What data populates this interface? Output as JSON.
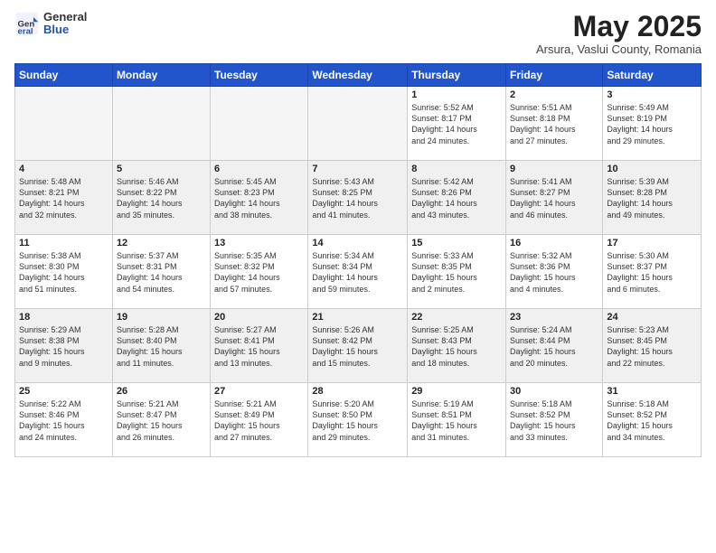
{
  "logo": {
    "general": "General",
    "blue": "Blue"
  },
  "title": "May 2025",
  "subtitle": "Arsura, Vaslui County, Romania",
  "headers": [
    "Sunday",
    "Monday",
    "Tuesday",
    "Wednesday",
    "Thursday",
    "Friday",
    "Saturday"
  ],
  "weeks": [
    [
      {
        "day": "",
        "info": ""
      },
      {
        "day": "",
        "info": ""
      },
      {
        "day": "",
        "info": ""
      },
      {
        "day": "",
        "info": ""
      },
      {
        "day": "1",
        "info": "Sunrise: 5:52 AM\nSunset: 8:17 PM\nDaylight: 14 hours\nand 24 minutes."
      },
      {
        "day": "2",
        "info": "Sunrise: 5:51 AM\nSunset: 8:18 PM\nDaylight: 14 hours\nand 27 minutes."
      },
      {
        "day": "3",
        "info": "Sunrise: 5:49 AM\nSunset: 8:19 PM\nDaylight: 14 hours\nand 29 minutes."
      }
    ],
    [
      {
        "day": "4",
        "info": "Sunrise: 5:48 AM\nSunset: 8:21 PM\nDaylight: 14 hours\nand 32 minutes."
      },
      {
        "day": "5",
        "info": "Sunrise: 5:46 AM\nSunset: 8:22 PM\nDaylight: 14 hours\nand 35 minutes."
      },
      {
        "day": "6",
        "info": "Sunrise: 5:45 AM\nSunset: 8:23 PM\nDaylight: 14 hours\nand 38 minutes."
      },
      {
        "day": "7",
        "info": "Sunrise: 5:43 AM\nSunset: 8:25 PM\nDaylight: 14 hours\nand 41 minutes."
      },
      {
        "day": "8",
        "info": "Sunrise: 5:42 AM\nSunset: 8:26 PM\nDaylight: 14 hours\nand 43 minutes."
      },
      {
        "day": "9",
        "info": "Sunrise: 5:41 AM\nSunset: 8:27 PM\nDaylight: 14 hours\nand 46 minutes."
      },
      {
        "day": "10",
        "info": "Sunrise: 5:39 AM\nSunset: 8:28 PM\nDaylight: 14 hours\nand 49 minutes."
      }
    ],
    [
      {
        "day": "11",
        "info": "Sunrise: 5:38 AM\nSunset: 8:30 PM\nDaylight: 14 hours\nand 51 minutes."
      },
      {
        "day": "12",
        "info": "Sunrise: 5:37 AM\nSunset: 8:31 PM\nDaylight: 14 hours\nand 54 minutes."
      },
      {
        "day": "13",
        "info": "Sunrise: 5:35 AM\nSunset: 8:32 PM\nDaylight: 14 hours\nand 57 minutes."
      },
      {
        "day": "14",
        "info": "Sunrise: 5:34 AM\nSunset: 8:34 PM\nDaylight: 14 hours\nand 59 minutes."
      },
      {
        "day": "15",
        "info": "Sunrise: 5:33 AM\nSunset: 8:35 PM\nDaylight: 15 hours\nand 2 minutes."
      },
      {
        "day": "16",
        "info": "Sunrise: 5:32 AM\nSunset: 8:36 PM\nDaylight: 15 hours\nand 4 minutes."
      },
      {
        "day": "17",
        "info": "Sunrise: 5:30 AM\nSunset: 8:37 PM\nDaylight: 15 hours\nand 6 minutes."
      }
    ],
    [
      {
        "day": "18",
        "info": "Sunrise: 5:29 AM\nSunset: 8:38 PM\nDaylight: 15 hours\nand 9 minutes."
      },
      {
        "day": "19",
        "info": "Sunrise: 5:28 AM\nSunset: 8:40 PM\nDaylight: 15 hours\nand 11 minutes."
      },
      {
        "day": "20",
        "info": "Sunrise: 5:27 AM\nSunset: 8:41 PM\nDaylight: 15 hours\nand 13 minutes."
      },
      {
        "day": "21",
        "info": "Sunrise: 5:26 AM\nSunset: 8:42 PM\nDaylight: 15 hours\nand 15 minutes."
      },
      {
        "day": "22",
        "info": "Sunrise: 5:25 AM\nSunset: 8:43 PM\nDaylight: 15 hours\nand 18 minutes."
      },
      {
        "day": "23",
        "info": "Sunrise: 5:24 AM\nSunset: 8:44 PM\nDaylight: 15 hours\nand 20 minutes."
      },
      {
        "day": "24",
        "info": "Sunrise: 5:23 AM\nSunset: 8:45 PM\nDaylight: 15 hours\nand 22 minutes."
      }
    ],
    [
      {
        "day": "25",
        "info": "Sunrise: 5:22 AM\nSunset: 8:46 PM\nDaylight: 15 hours\nand 24 minutes."
      },
      {
        "day": "26",
        "info": "Sunrise: 5:21 AM\nSunset: 8:47 PM\nDaylight: 15 hours\nand 26 minutes."
      },
      {
        "day": "27",
        "info": "Sunrise: 5:21 AM\nSunset: 8:49 PM\nDaylight: 15 hours\nand 27 minutes."
      },
      {
        "day": "28",
        "info": "Sunrise: 5:20 AM\nSunset: 8:50 PM\nDaylight: 15 hours\nand 29 minutes."
      },
      {
        "day": "29",
        "info": "Sunrise: 5:19 AM\nSunset: 8:51 PM\nDaylight: 15 hours\nand 31 minutes."
      },
      {
        "day": "30",
        "info": "Sunrise: 5:18 AM\nSunset: 8:52 PM\nDaylight: 15 hours\nand 33 minutes."
      },
      {
        "day": "31",
        "info": "Sunrise: 5:18 AM\nSunset: 8:52 PM\nDaylight: 15 hours\nand 34 minutes."
      }
    ]
  ]
}
